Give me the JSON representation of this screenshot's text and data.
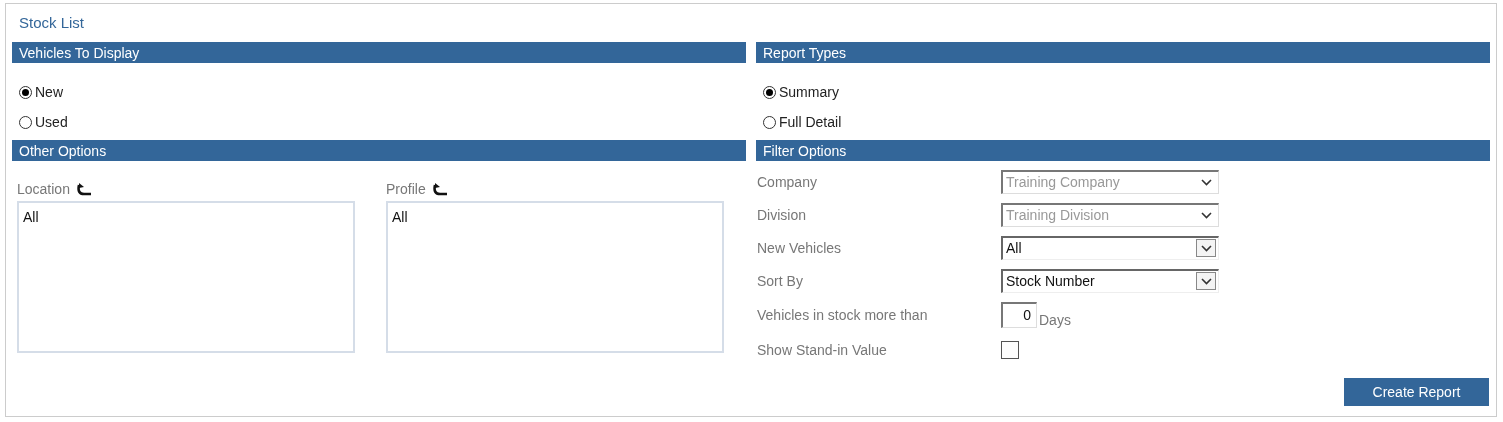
{
  "title": "Stock List",
  "vehicles": {
    "header": "Vehicles To Display",
    "options": [
      {
        "label": "New",
        "selected": true
      },
      {
        "label": "Used",
        "selected": false
      }
    ]
  },
  "report_types": {
    "header": "Report Types",
    "options": [
      {
        "label": "Summary",
        "selected": true
      },
      {
        "label": "Full Detail",
        "selected": false
      }
    ]
  },
  "other_options": {
    "header": "Other Options",
    "lists": [
      {
        "label": "Location",
        "items": [
          "All"
        ]
      },
      {
        "label": "Profile",
        "items": [
          "All"
        ]
      }
    ]
  },
  "filter_options": {
    "header": "Filter Options",
    "rows": [
      {
        "kind": "select",
        "label": "Company",
        "value": "Training Company",
        "disabled": true
      },
      {
        "kind": "select",
        "label": "Division",
        "value": "Training Division",
        "disabled": true
      },
      {
        "kind": "select",
        "label": "New Vehicles",
        "value": "All",
        "disabled": false
      },
      {
        "kind": "select",
        "label": "Sort By",
        "value": "Stock Number",
        "disabled": false
      },
      {
        "kind": "number",
        "label": "Vehicles in stock more than",
        "value": "0",
        "unit": "Days"
      },
      {
        "kind": "checkbox",
        "label": "Show Stand-in Value",
        "checked": false
      }
    ]
  },
  "button": "Create Report"
}
